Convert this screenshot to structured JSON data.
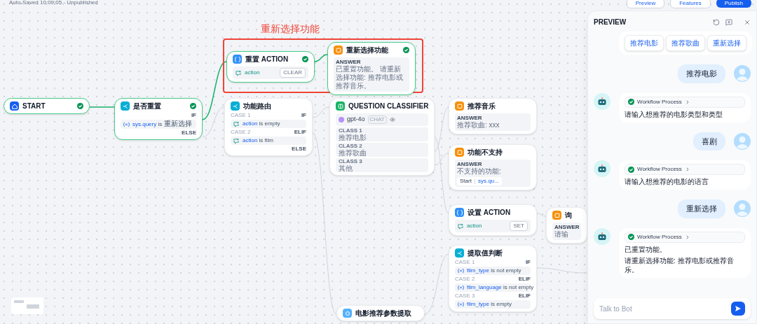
{
  "header": {
    "status": "Auto-Saved 10:09:05 - Unpublished",
    "buttons": [
      {
        "label": "Preview",
        "kind": "outline"
      },
      {
        "label": "Features",
        "kind": "outline"
      },
      {
        "label": "Publish",
        "kind": "primary"
      }
    ]
  },
  "annotation": {
    "label": "重新选择功能"
  },
  "nodes": [
    {
      "kind": "start",
      "title": "START",
      "checked": true,
      "selected": true
    },
    {
      "kind": "if",
      "title": "是否重置",
      "checked": true,
      "selected": true,
      "branches": [
        {
          "port": "IF",
          "conditions": [
            {
              "kind": "sys",
              "var": "sys.query",
              "op": "is",
              "value": "重新选择"
            }
          ]
        }
      ],
      "else": "ELSE"
    },
    {
      "kind": "action",
      "title": "重置 ACTION",
      "checked": true,
      "selected": true,
      "var": "action",
      "op": "CLEAR"
    },
    {
      "kind": "answer",
      "title": "重新选择功能",
      "checked": true,
      "selected": true,
      "label": "ANSWER",
      "text": "已重置功能。 请重新选择功能: 推荐电影或推荐音乐。"
    },
    {
      "kind": "if",
      "title": "功能路由",
      "checked": false,
      "selected": false,
      "branches": [
        {
          "case": "CASE 1",
          "port": "IF",
          "conditions": [
            {
              "kind": "conv",
              "var": "action",
              "op": "is empty"
            }
          ]
        },
        {
          "case": "CASE 2",
          "port": "ELIF",
          "conditions": [
            {
              "kind": "conv",
              "var": "action",
              "op": "is film"
            }
          ]
        }
      ],
      "else": "ELSE"
    },
    {
      "kind": "classifier",
      "title": "QUESTION CLASSIFIER",
      "checked": false,
      "selected": false,
      "model": "gpt-4o",
      "mode": "CHAT",
      "classes": [
        {
          "label": "CLASS 1",
          "text": "推荐电影"
        },
        {
          "label": "CLASS 2",
          "text": "推荐歌曲"
        },
        {
          "label": "CLASS 3",
          "text": "其他"
        }
      ]
    },
    {
      "kind": "answer",
      "title": "推荐音乐",
      "checked": false,
      "selected": false,
      "label": "ANSWER",
      "text": "推荐歌曲: xxx"
    },
    {
      "kind": "answer",
      "title": "功能不支持",
      "checked": false,
      "selected": false,
      "label": "ANSWER",
      "text": "不支持的功能:",
      "ref": {
        "node": "Start",
        "var": "sys.qu..."
      }
    },
    {
      "kind": "action",
      "title": "设置 ACTION",
      "checked": false,
      "selected": false,
      "var": "action",
      "op": "SET"
    },
    {
      "kind": "answer",
      "title": "询",
      "checked": false,
      "selected": false,
      "label": "ANSWER",
      "text": "请输"
    },
    {
      "kind": "if",
      "title": "提取值判断",
      "checked": false,
      "selected": false,
      "branches": [
        {
          "case": "CASE 1",
          "port": "IF",
          "conditions": [
            {
              "kind": "sys",
              "var": "film_type",
              "op": "is not empty"
            }
          ]
        },
        {
          "case": "CASE 2",
          "port": "ELIF",
          "conditions": [
            {
              "kind": "sys",
              "var": "film_language",
              "op": "is not empty"
            }
          ]
        },
        {
          "case": "CASE 3",
          "port": "ELIF",
          "conditions": [
            {
              "kind": "sys",
              "var": "film_type",
              "op": "is empty"
            }
          ]
        }
      ]
    },
    {
      "kind": "extractor",
      "title": "电影推荐参数提取",
      "checked": false,
      "selected": false
    }
  ],
  "preview": {
    "title": "PREVIEW",
    "messages": [
      {
        "kind": "bot",
        "suggestions": [
          "推荐电影",
          "推荐歌曲",
          "重新选择"
        ]
      },
      {
        "kind": "user",
        "text": "推荐电影"
      },
      {
        "kind": "bot",
        "process": "Workflow Process",
        "lines": [
          "请输入想推荐的电影类型和类型"
        ]
      },
      {
        "kind": "user",
        "text": "喜剧"
      },
      {
        "kind": "bot",
        "process": "Workflow Process",
        "lines": [
          "请输入想推荐的电影的语言"
        ]
      },
      {
        "kind": "user",
        "text": "重新选择"
      },
      {
        "kind": "bot",
        "process": "Workflow Process",
        "lines": [
          "已重置功能。",
          "请重新选择功能: 推荐电影或推荐音乐。"
        ]
      }
    ],
    "input": {
      "placeholder": "Talk to Bot"
    }
  }
}
